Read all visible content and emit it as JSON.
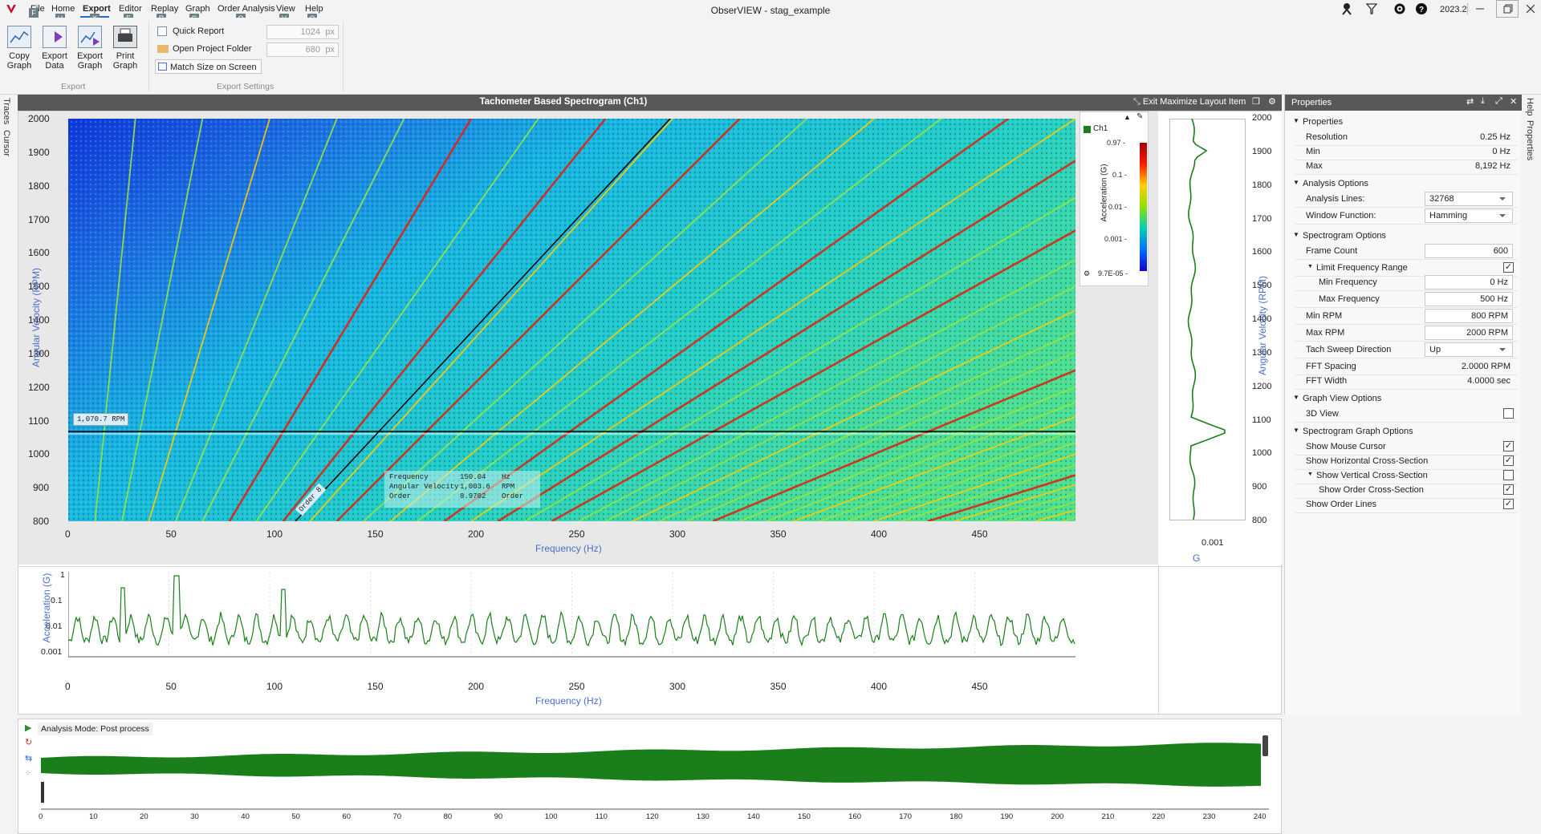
{
  "app": {
    "title": "ObserVIEW - stag_example",
    "version": "2023.2"
  },
  "menu": {
    "items": [
      {
        "label": "File",
        "key": "F",
        "active": false
      },
      {
        "label": "Home",
        "key": "H",
        "active": false
      },
      {
        "label": "Export",
        "key": "X",
        "active": true
      },
      {
        "label": "Editor",
        "key": "E",
        "active": false
      },
      {
        "label": "Replay",
        "key": "R",
        "active": false
      },
      {
        "label": "Graph",
        "key": "G",
        "active": false
      },
      {
        "label": "Order Analysis",
        "key": "O",
        "active": false
      },
      {
        "label": "View",
        "key": "V",
        "active": false
      },
      {
        "label": "Help",
        "key": "Q",
        "active": false
      }
    ]
  },
  "ribbon": {
    "export_buttons": [
      {
        "line1": "Copy",
        "line2": "Graph"
      },
      {
        "line1": "Export",
        "line2": "Data"
      },
      {
        "line1": "Export",
        "line2": "Graph"
      },
      {
        "line1": "Print",
        "line2": "Graph"
      }
    ],
    "export_group_label": "Export",
    "quick_report": "Quick Report",
    "open_project_folder": "Open Project Folder",
    "match_size": "Match Size on Screen",
    "width_value": "1024",
    "height_value": "680",
    "px_unit": "px",
    "export_settings_label": "Export Settings"
  },
  "side_tabs": {
    "traces": "Traces",
    "cursor": "Cursor",
    "help": "Help",
    "properties": "Properties"
  },
  "spectrogram": {
    "panel_title": "Tachometer Based Spectrogram (Ch1)",
    "exit_maximize": "Exit Maximize Layout Item",
    "y_title": "Angular Velocity (RPM)",
    "x_title": "Frequency (Hz)",
    "y_ticks": [
      "2000",
      "1900",
      "1800",
      "1700",
      "1600",
      "1500",
      "1400",
      "1300",
      "1200",
      "1100",
      "1000",
      "900",
      "800"
    ],
    "x_ticks": [
      "0",
      "50",
      "100",
      "150",
      "200",
      "250",
      "300",
      "350",
      "400",
      "450"
    ],
    "cursor_rpm_label": "1,070.7 RPM",
    "order_label": "Order 8",
    "tooltip": [
      {
        "name": "Frequency",
        "value": "150.04",
        "unit": "Hz"
      },
      {
        "name": "Angular Velocity",
        "value": "1,003.6",
        "unit": "RPM"
      },
      {
        "name": "Order",
        "value": "8.9702",
        "unit": "Order"
      }
    ],
    "legend": {
      "channel": "Ch1",
      "axis_title": "Acceleration (G)",
      "ticks": [
        "0.97 -",
        "0.1 -",
        "0.01 -",
        "0.001 -",
        "9.7E-05 -"
      ]
    },
    "colors": {
      "base": "#1a3fd6",
      "ch1": "#1a7f1a"
    }
  },
  "rpm_profile": {
    "y_title": "Angular Velocity (RPM)",
    "x_tick": "0.001",
    "x_title": "G",
    "y_ticks": [
      "2000",
      "1900",
      "1800",
      "1700",
      "1600",
      "1500",
      "1400",
      "1300",
      "1200",
      "1100",
      "1000",
      "900",
      "800"
    ]
  },
  "cross_section": {
    "y_title": "Acceleration (G)",
    "x_title": "Frequency (Hz)",
    "y_ticks": [
      "1",
      "0.1",
      "0.01",
      "0.001"
    ],
    "x_ticks": [
      "0",
      "50",
      "100",
      "150",
      "200",
      "250",
      "300",
      "350",
      "400",
      "450"
    ]
  },
  "overview": {
    "mode": "Analysis Mode: Post process",
    "x_ticks": [
      "0",
      "10",
      "20",
      "30",
      "40",
      "50",
      "60",
      "70",
      "80",
      "90",
      "100",
      "110",
      "120",
      "130",
      "140",
      "150",
      "160",
      "170",
      "180",
      "190",
      "200",
      "210",
      "220",
      "230",
      "240"
    ]
  },
  "properties": {
    "title": "Properties",
    "rows": [
      {
        "type": "section",
        "label": "Properties"
      },
      {
        "type": "text",
        "label": "Resolution",
        "value": "0.25 Hz"
      },
      {
        "type": "text",
        "label": "Min",
        "value": "0 Hz"
      },
      {
        "type": "text",
        "label": "Max",
        "value": "8,192 Hz"
      },
      {
        "type": "section",
        "label": "Analysis Options"
      },
      {
        "type": "dropdown",
        "label": "Analysis Lines:",
        "value": "32768"
      },
      {
        "type": "dropdown",
        "label": "Window Function:",
        "value": "Hamming"
      },
      {
        "type": "section",
        "label": "Spectrogram Options"
      },
      {
        "type": "box",
        "label": "Frame Count",
        "value": "600"
      },
      {
        "type": "check",
        "label": "Limit Frequency Range",
        "value": "✓",
        "sub": true
      },
      {
        "type": "box",
        "label": "Min Frequency",
        "value": "0  Hz",
        "indent": true
      },
      {
        "type": "box",
        "label": "Max Frequency",
        "value": "500  Hz",
        "indent": true
      },
      {
        "type": "box",
        "label": "Min RPM",
        "value": "800  RPM"
      },
      {
        "type": "box",
        "label": "Max RPM",
        "value": "2000  RPM"
      },
      {
        "type": "dropdown",
        "label": "Tach Sweep Direction",
        "value": "Up"
      },
      {
        "type": "text",
        "label": "FFT Spacing",
        "value": "2.0000 RPM"
      },
      {
        "type": "text",
        "label": "FFT Width",
        "value": "4.0000 sec"
      },
      {
        "type": "section",
        "label": "Graph View Options"
      },
      {
        "type": "check",
        "label": "3D View",
        "value": ""
      },
      {
        "type": "section",
        "label": "Spectrogram Graph Options"
      },
      {
        "type": "check",
        "label": "Show Mouse Cursor",
        "value": "✓"
      },
      {
        "type": "check",
        "label": "Show Horizontal Cross-Section",
        "value": "✓"
      },
      {
        "type": "check",
        "label": "Show Vertical Cross-Section",
        "value": "",
        "sub": true
      },
      {
        "type": "check",
        "label": "Show Order Cross-Section",
        "value": "✓",
        "indent": true
      },
      {
        "type": "check",
        "label": "Show Order Lines",
        "value": "✓"
      }
    ]
  }
}
